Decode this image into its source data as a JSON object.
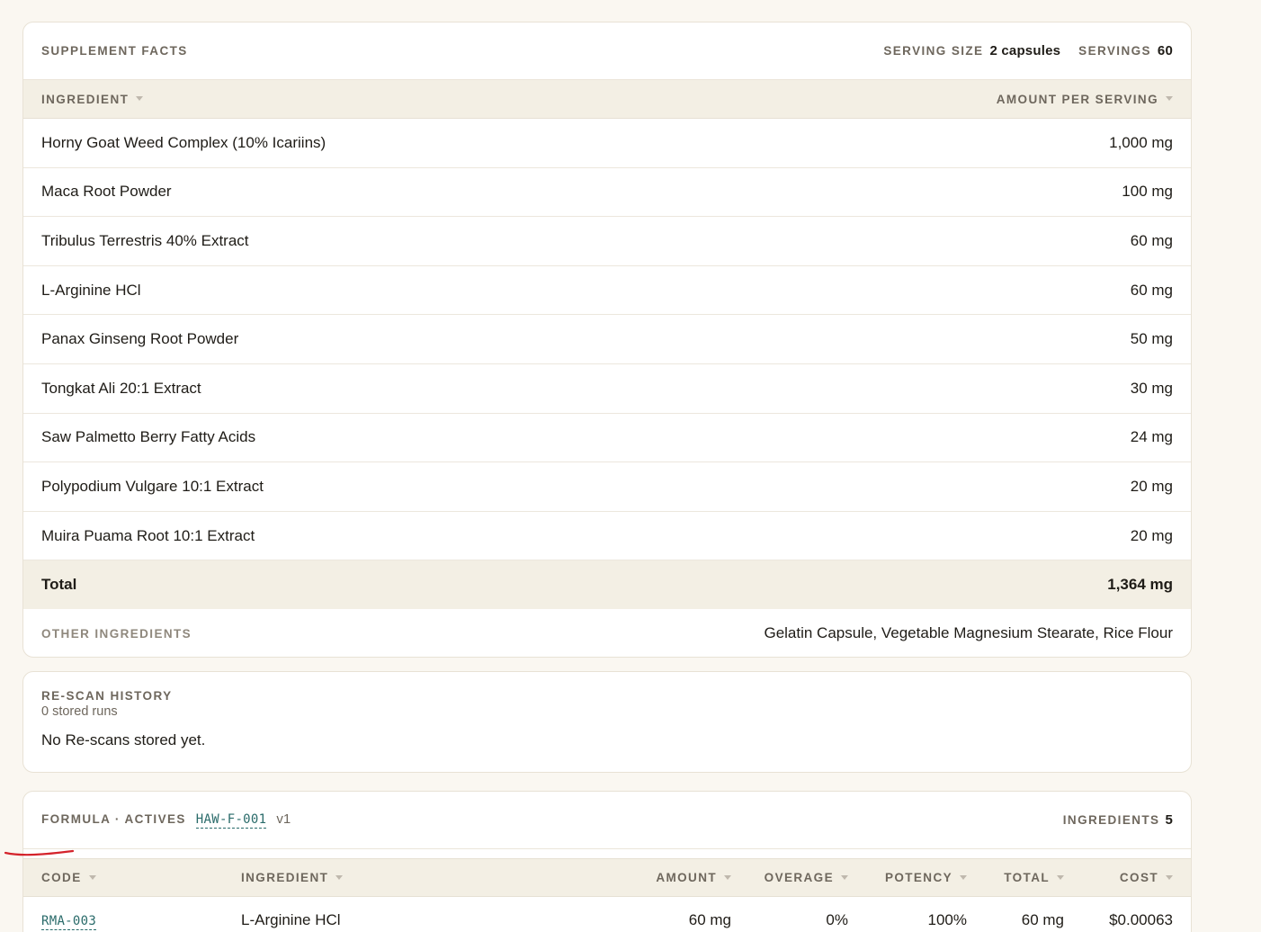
{
  "facts": {
    "title": "Supplement Facts",
    "serving_size_label": "Serving Size",
    "serving_size_value": "2 capsules",
    "servings_label": "Servings",
    "servings_value": "60",
    "col_ingredient": "Ingredient",
    "col_amount": "Amount Per Serving",
    "rows": [
      {
        "name": "Horny Goat Weed Complex (10% Icariins)",
        "amount": "1,000 mg"
      },
      {
        "name": "Maca Root Powder",
        "amount": "100 mg"
      },
      {
        "name": "Tribulus Terrestris 40% Extract",
        "amount": "60 mg"
      },
      {
        "name": "L-Arginine HCl",
        "amount": "60 mg"
      },
      {
        "name": "Panax Ginseng Root Powder",
        "amount": "50 mg"
      },
      {
        "name": "Tongkat Ali 20:1 Extract",
        "amount": "30 mg"
      },
      {
        "name": "Saw Palmetto Berry Fatty Acids",
        "amount": "24 mg"
      },
      {
        "name": "Polypodium Vulgare 10:1 Extract",
        "amount": "20 mg"
      },
      {
        "name": "Muira Puama Root 10:1 Extract",
        "amount": "20 mg"
      }
    ],
    "total_label": "Total",
    "total_value": "1,364 mg",
    "other_label": "Other Ingredients",
    "other_value": "Gelatin Capsule, Vegetable Magnesium Stearate, Rice Flour"
  },
  "rescan": {
    "title": "Re-scan History",
    "count": "0 stored runs",
    "empty": "No Re-scans stored yet."
  },
  "formula": {
    "title": "Formula · Actives",
    "code": "HAW-F-001",
    "version": "v1",
    "ingredients_label": "Ingredients",
    "ingredients_count": "5",
    "columns": [
      "Code",
      "Ingredient",
      "Amount",
      "Overage",
      "Potency",
      "Total",
      "Cost"
    ],
    "rows": [
      {
        "code": "RMA-003",
        "ingredient": "L-Arginine HCl",
        "amount": "60 mg",
        "overage": "0%",
        "potency": "100%",
        "total": "60 mg",
        "cost": "$0.00063"
      }
    ]
  },
  "colors": {
    "accent": "#2a6b6a",
    "pen_mark": "#d4232b"
  }
}
